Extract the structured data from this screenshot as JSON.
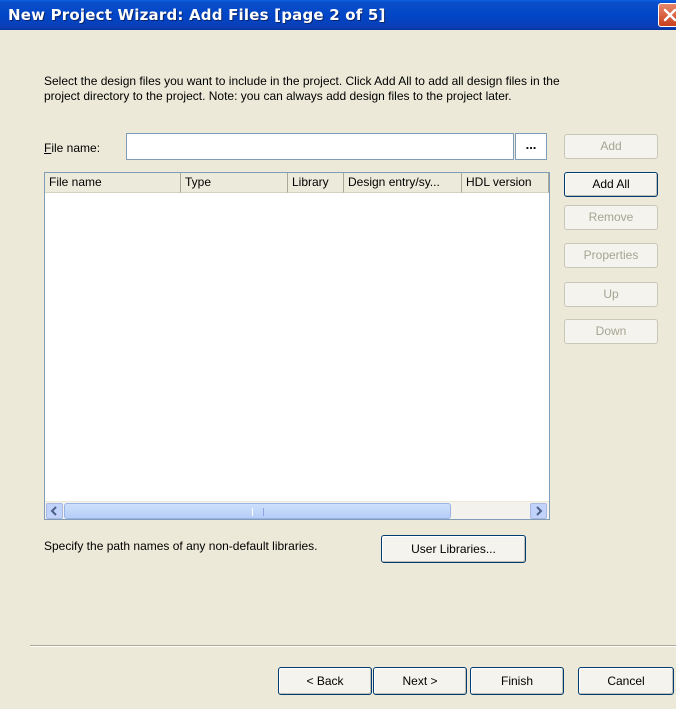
{
  "window": {
    "title": "New Project Wizard: Add Files [page 2 of 5]"
  },
  "instructions": {
    "line1": "Select the design files you want to include in the project. Click Add All to add all design files in the",
    "line2": "project directory to the project. Note: you can always add design files to the project later."
  },
  "file_name": {
    "label_mnemonic": "F",
    "label_rest": "ile name:",
    "value": "",
    "browse_label": "..."
  },
  "side_buttons": {
    "add": "Add",
    "add_all": "Add All",
    "remove": "Remove",
    "properties": "Properties",
    "up": "Up",
    "down": "Down"
  },
  "file_list": {
    "columns": [
      "File name",
      "Type",
      "Library",
      "Design entry/sy...",
      "HDL version"
    ],
    "rows": []
  },
  "libraries": {
    "text": "Specify the path names of any non-default libraries.",
    "button": "User Libraries..."
  },
  "footer": {
    "back": "< Back",
    "next": "Next >",
    "finish": "Finish",
    "cancel": "Cancel"
  },
  "icons": {
    "close": "close-icon",
    "scroll_left": "arrow-left-icon",
    "scroll_right": "arrow-right-icon"
  },
  "colors": {
    "titlebar": "#0046c8",
    "dialog_bg": "#ece9d8",
    "scroll": "#c1d3fb",
    "close": "#c9401e",
    "disabled_text": "#a6a592"
  }
}
